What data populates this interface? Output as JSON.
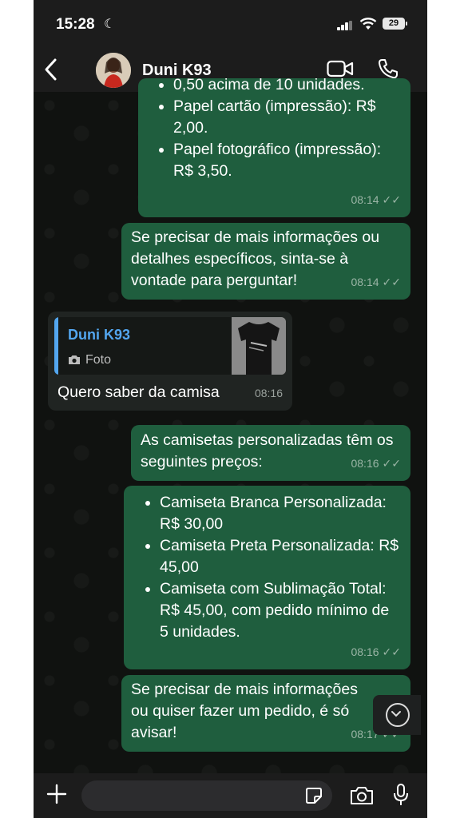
{
  "status": {
    "time": "15:28",
    "battery": "29"
  },
  "header": {
    "contact_name": "Duni K93"
  },
  "messages": {
    "m1": {
      "items": [
        "0,50 acima de 10 unidades.",
        "Papel cartão (impressão): R$ 2,00.",
        "Papel fotográfico (impressão): R$ 3,50."
      ],
      "time": "08:14"
    },
    "m2": {
      "text": "Se precisar de mais informações ou detalhes específicos, sinta-se à vontade para perguntar!",
      "time": "08:14"
    },
    "m3": {
      "quote_name": "Duni K93",
      "quote_type": "Foto",
      "text": "Quero saber da camisa",
      "time": "08:16"
    },
    "m4": {
      "text": "As camisetas personalizadas têm os seguintes preços:",
      "time": "08:16"
    },
    "m5": {
      "items": [
        "Camiseta Branca Personalizada: R$ 30,00",
        "Camiseta Preta Personalizada: R$ 45,00",
        "Camiseta com Sublimação Total: R$ 45,00, com pedido mínimo de 5 unidades."
      ],
      "time": "08:16"
    },
    "m6": {
      "text": "Se precisar de mais informações ou quiser fazer um pedido, é só avisar!",
      "time": "08:17"
    }
  },
  "composer": {
    "placeholder": ""
  },
  "colors": {
    "outgoing_bubble": "#1f5e3e",
    "incoming_bubble": "#202422",
    "quote_accent": "#53a6ef"
  }
}
